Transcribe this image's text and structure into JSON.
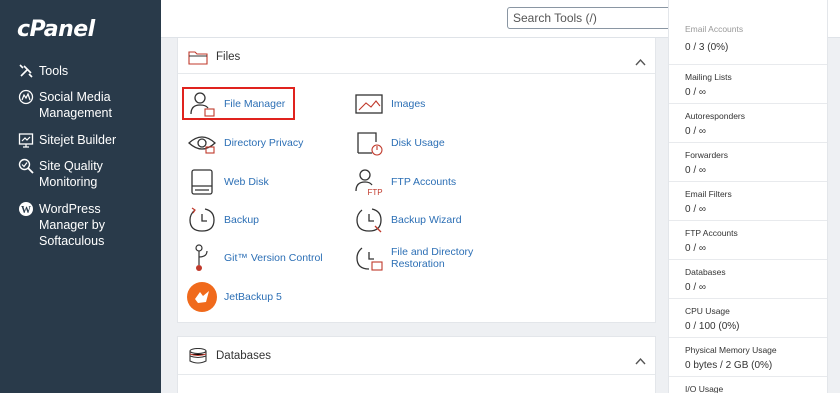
{
  "brand": {
    "logo_text": "cPanel"
  },
  "sidebar": {
    "items": [
      {
        "label": "Tools",
        "icon": "tools-icon"
      },
      {
        "label": "Social Media\nManagement",
        "icon": "social-media-icon"
      },
      {
        "label": "Sitejet Builder",
        "icon": "sitejet-icon"
      },
      {
        "label": "Site Quality\nMonitoring",
        "icon": "site-quality-icon"
      },
      {
        "label": "WordPress\nManager by\nSoftaculous",
        "icon": "wordpress-icon"
      }
    ]
  },
  "header": {
    "search_placeholder": "Search Tools (/)",
    "notifications_icon": "bell-icon",
    "user_icon": "user-icon"
  },
  "files": {
    "title": "Files",
    "tools": [
      {
        "label": "File Manager",
        "icon": "file-manager-icon"
      },
      {
        "label": "Images",
        "icon": "images-icon"
      },
      {
        "label": "Directory Privacy",
        "icon": "directory-privacy-icon"
      },
      {
        "label": "Disk Usage",
        "icon": "disk-usage-icon"
      },
      {
        "label": "Web Disk",
        "icon": "web-disk-icon"
      },
      {
        "label": "FTP Accounts",
        "icon": "ftp-accounts-icon"
      },
      {
        "label": "Backup",
        "icon": "backup-icon"
      },
      {
        "label": "Backup Wizard",
        "icon": "backup-wizard-icon"
      },
      {
        "label": "Git™ Version Control",
        "icon": "git-icon"
      },
      {
        "label": "File and Directory\nRestoration",
        "icon": "restoration-icon"
      },
      {
        "label": "JetBackup 5",
        "icon": "jetbackup-icon"
      }
    ]
  },
  "databases": {
    "title": "Databases"
  },
  "stats": [
    {
      "label": "Email Accounts",
      "value": "0 / 3   (0%)"
    },
    {
      "label": "Mailing Lists",
      "value": "0 / ∞"
    },
    {
      "label": "Autoresponders",
      "value": "0 / ∞"
    },
    {
      "label": "Forwarders",
      "value": "0 / ∞"
    },
    {
      "label": "Email Filters",
      "value": "0 / ∞"
    },
    {
      "label": "FTP Accounts",
      "value": "0 / ∞"
    },
    {
      "label": "Databases",
      "value": "0 / ∞"
    },
    {
      "label": "CPU Usage",
      "value": "0 / 100   (0%)"
    },
    {
      "label": "Physical Memory Usage",
      "value": "0 bytes / 2 GB   (0%)"
    },
    {
      "label": "I/O Usage",
      "value": ""
    }
  ],
  "colors": {
    "sidebar_bg": "#293a4a",
    "link": "#2c6fb5",
    "highlight": "#e0231e",
    "jetbackup": "#f06a1c"
  }
}
